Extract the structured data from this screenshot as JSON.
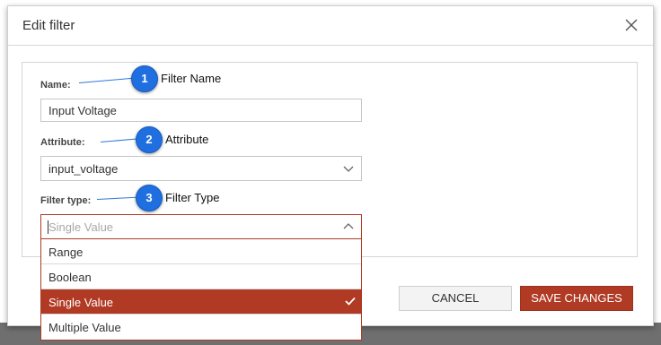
{
  "dialog": {
    "title": "Edit filter",
    "close_icon": "close-icon"
  },
  "form": {
    "name": {
      "label": "Name:",
      "value": "Input Voltage"
    },
    "attribute": {
      "label": "Attribute:",
      "value": "input_voltage",
      "icon": "chevron-down-icon"
    },
    "filter_type": {
      "label": "Filter type:",
      "placeholder": "Single Value",
      "icon": "chevron-up-icon",
      "options": [
        {
          "label": "Range",
          "selected": false
        },
        {
          "label": "Boolean",
          "selected": false
        },
        {
          "label": "Single Value",
          "selected": true
        },
        {
          "label": "Multiple Value",
          "selected": false
        }
      ]
    }
  },
  "buttons": {
    "cancel": "CANCEL",
    "save": "SAVE CHANGES"
  },
  "annotations": [
    {
      "number": "1",
      "label": "Filter Name"
    },
    {
      "number": "2",
      "label": "Attribute"
    },
    {
      "number": "3",
      "label": "Filter Type"
    }
  ],
  "colors": {
    "accent": "#b03a24",
    "annotation_blue": "#1f6fe0"
  }
}
